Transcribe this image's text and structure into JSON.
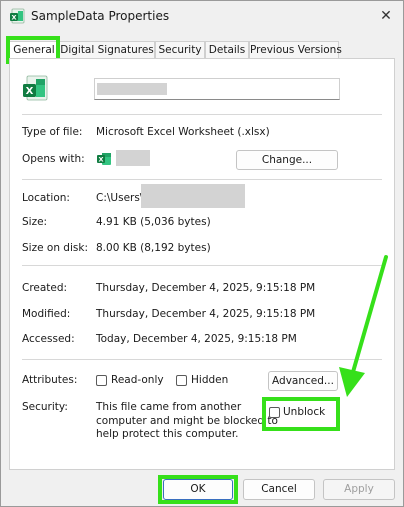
{
  "window": {
    "title": "SampleData Properties",
    "close_glyph": "✕",
    "icon": "excel-file-icon"
  },
  "tabs": [
    {
      "label": "General",
      "active": true
    },
    {
      "label": "Digital Signatures",
      "active": false
    },
    {
      "label": "Security",
      "active": false
    },
    {
      "label": "Details",
      "active": false
    },
    {
      "label": "Previous Versions",
      "active": false
    }
  ],
  "general": {
    "file_icon": "excel-file-icon",
    "type_of_file": {
      "label": "Type of file:",
      "value": "Microsoft Excel Worksheet (.xlsx)"
    },
    "opens_with": {
      "label": "Opens with:",
      "icon": "excel-app-icon",
      "change_label": "Change..."
    },
    "location": {
      "label": "Location:",
      "value": "C:\\Users\\"
    },
    "size": {
      "label": "Size:",
      "value": "4.91 KB (5,036 bytes)"
    },
    "size_on_disk": {
      "label": "Size on disk:",
      "value": "8.00 KB (8,192 bytes)"
    },
    "created": {
      "label": "Created:",
      "value": "Thursday, December 4, 2025, 9:15:18 PM"
    },
    "modified": {
      "label": "Modified:",
      "value": "Thursday, December 4, 2025, 9:15:18 PM"
    },
    "accessed": {
      "label": "Accessed:",
      "value": "Today, December 4, 2025, 9:15:18 PM"
    },
    "attributes": {
      "label": "Attributes:",
      "readonly_label": "Read-only",
      "readonly_checked": false,
      "hidden_label": "Hidden",
      "hidden_checked": false,
      "advanced_label": "Advanced..."
    },
    "security": {
      "label": "Security:",
      "line1": "This file came from another",
      "line2": "computer and might be blocked to",
      "line3": "help protect this computer.",
      "unblock_label": "Unblock",
      "unblock_checked": false
    }
  },
  "footer": {
    "ok_label": "OK",
    "cancel_label": "Cancel",
    "apply_label": "Apply"
  },
  "annotations": {
    "highlight_color": "#36e01a",
    "arrow_color": "#36e01a"
  }
}
